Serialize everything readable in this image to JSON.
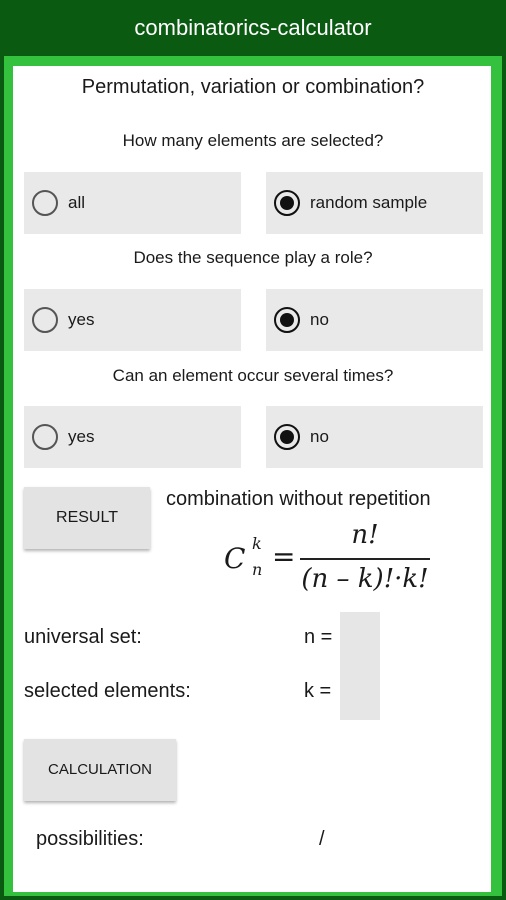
{
  "app": {
    "title": "combinatorics-calculator"
  },
  "heading": "Permutation, variation or combination?",
  "q1": {
    "text": "How many elements are selected?",
    "opt_a": "all",
    "opt_b": "random sample",
    "selected": "random sample"
  },
  "q2": {
    "text": "Does the sequence play a role?",
    "opt_a": "yes",
    "opt_b": "no",
    "selected": "no"
  },
  "q3": {
    "text": "Can an element occur several times?",
    "opt_a": "yes",
    "opt_b": "no",
    "selected": "no"
  },
  "result": {
    "button_label": "RESULT",
    "type_text": "combination without repetition",
    "formula": {
      "lhs": "C",
      "sup": "k",
      "sub": "n",
      "eq": "=",
      "numerator": "n!",
      "denominator": "(n – k)!·k!"
    }
  },
  "inputs": {
    "universal_label": "universal set:",
    "n_label": "n =",
    "selected_label": "selected elements:",
    "k_label": "k =",
    "n_value": "",
    "k_value": ""
  },
  "calc": {
    "button_label": "CALCULATION"
  },
  "output": {
    "label": "possibilities:",
    "value": "/"
  }
}
